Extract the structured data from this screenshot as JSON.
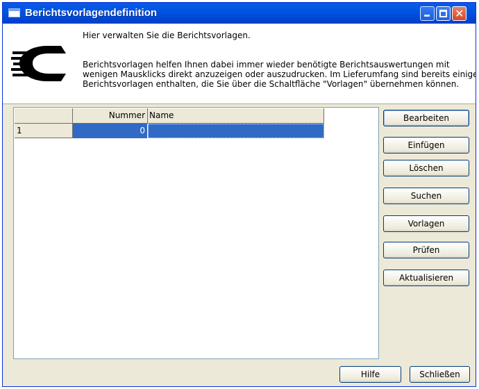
{
  "window": {
    "title": "Berichtsvorlagendefinition"
  },
  "header": {
    "line1": "Hier verwalten Sie die Berichtsvorlagen.",
    "line2": "Berichtsvorlagen helfen Ihnen dabei immer wieder benötigte Berichtsauswertungen mit",
    "line3": "wenigen Mausklicks direkt anzuzeigen oder auszudrucken. Im Lieferumfang sind bereits einige",
    "line4": "Berichtsvorlagen enthalten, die Sie über die Schaltfläche \"Vorlagen\" übernehmen können."
  },
  "grid": {
    "columns": [
      "",
      "Nummer",
      "Name"
    ],
    "rows": [
      {
        "row": "1",
        "nummer": "0",
        "name": ""
      }
    ]
  },
  "buttons": {
    "bearbeiten": "Bearbeiten",
    "einfuegen": "Einfügen",
    "loeschen": "Löschen",
    "suchen": "Suchen",
    "vorlagen": "Vorlagen",
    "pruefen": "Prüfen",
    "aktualisieren": "Aktualisieren",
    "hilfe": "Hilfe",
    "schliessen": "Schließen"
  },
  "icons": {
    "app": "window-icon",
    "logo": "company-logo",
    "close": "close-icon",
    "minimize": "minimize-icon",
    "maximize": "maximize-icon"
  },
  "colors": {
    "titlebar": "#0054e3",
    "selection": "#316ac5",
    "dialog_bg": "#ece9d8"
  }
}
